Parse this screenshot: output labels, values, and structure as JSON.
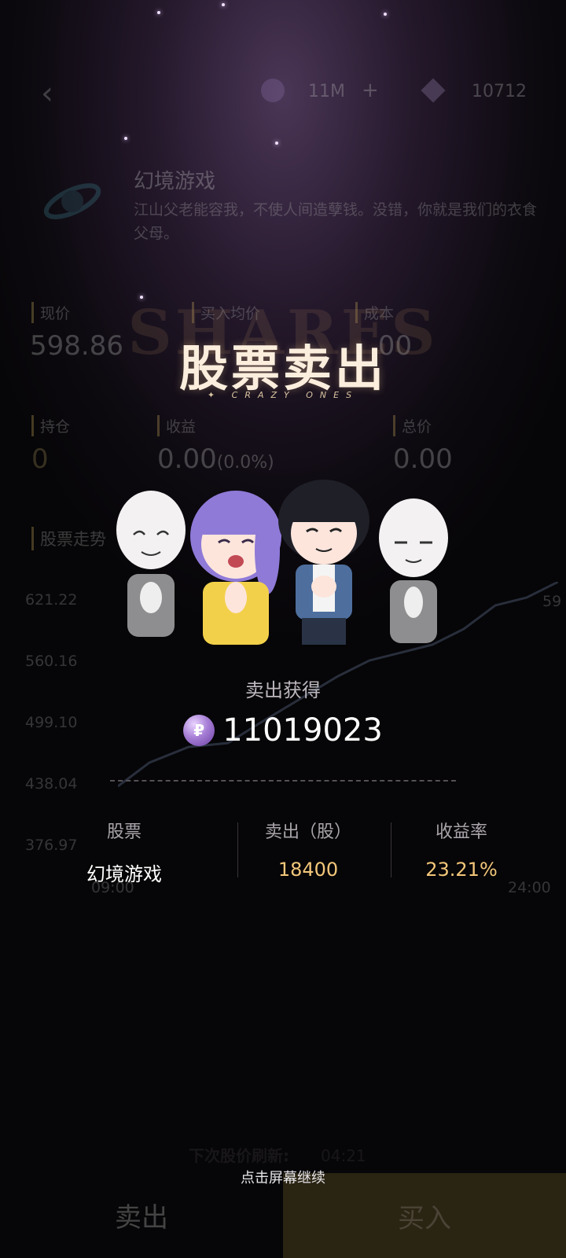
{
  "background_page": {
    "back_icon": "chevron-left-icon",
    "coins": "11M",
    "plus": "+",
    "gems": "10712",
    "company_name": "幻境游戏",
    "company_desc": "江山父老能容我，不使人间造孽钱。没错，你就是我们的衣食父母。",
    "stats": [
      {
        "label": "现价",
        "value": "598.86"
      },
      {
        "label": "买入均价",
        "value": ""
      },
      {
        "label": "成本",
        "value": ".00"
      },
      {
        "label": "持仓",
        "value": "0"
      },
      {
        "label": "收益",
        "value": "0.00",
        "sub": "(0.0%)"
      },
      {
        "label": "总价",
        "value": "0.00"
      }
    ],
    "chart_label": "股票走势",
    "y_ticks": [
      "621.22",
      "560.16",
      "499.10",
      "438.04",
      "376.97"
    ],
    "x_ticks": [
      "09:00",
      "24:00"
    ],
    "refresh_label": "下次股价刷新:",
    "refresh_time": "04:21",
    "sell_button": "卖出",
    "buy_button": "买入",
    "edge_value": "59"
  },
  "overlay": {
    "watermark": "SHARES",
    "title": "股票卖出",
    "subtitle": "CRAZY ONES",
    "earn_label": "卖出获得",
    "earn_value": "11019023",
    "earn_icon": "purple-coin-icon",
    "columns": [
      {
        "header": "股票",
        "value": "幻境游戏",
        "color": "#ffffff"
      },
      {
        "header": "卖出（股）",
        "value": "18400",
        "color": "#f3c77a"
      },
      {
        "header": "收益率",
        "value": "23.21%",
        "color": "#f3c77a"
      }
    ],
    "tap_hint": "点击屏幕继续"
  }
}
